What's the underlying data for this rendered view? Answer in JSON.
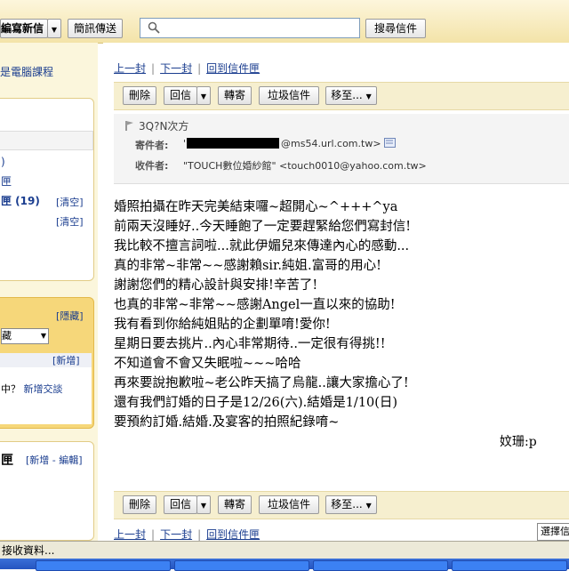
{
  "topbar": {
    "compose_label": "編寫新信",
    "im_label": "簡訊傳送",
    "search_placeholder": "",
    "search_button": "搜尋信件"
  },
  "sidebar": {
    "course_link": "電腦課程",
    "folder_count_fragment": ")",
    "folder_fragment": "匣",
    "trash_label": "匣 (19)",
    "clear_1": "[清空]",
    "clear_2": "[清空]",
    "hide_label": "[隱藏]",
    "dropdown_value": "藏",
    "add_label": "[新增]",
    "chat_fragment": "中？",
    "add_chat": "新增交談",
    "contacts_label": "匣",
    "contacts_actions": "[新增 - 編輯]"
  },
  "nav": {
    "prev": "上一封",
    "next": "下一封",
    "back": "回到信件匣"
  },
  "toolbar": {
    "delete": "刪除",
    "reply": "回信",
    "forward": "轉寄",
    "spam": "垃圾信件",
    "move": "移至..."
  },
  "header": {
    "subject": "3Q?N次方",
    "from_label": "寄件者:",
    "from_prefix": "'",
    "from_suffix": "@ms54.url.com.tw>",
    "to_label": "收件者:",
    "to_value": "\"TOUCH數位婚紗館\" <touch0010@yahoo.com.tw>"
  },
  "body": {
    "lines": [
      "婚照拍攝在昨天完美結束囉~超開心~^+++^ya",
      "前兩天沒睡好..今天睡飽了一定要趕緊給您們寫封信!",
      "我比較不擅言詞啦...就此伊媚兒來傳達內心的感動...",
      "真的非常~非常~~感謝賴sir.純姐.富哥的用心!",
      "謝謝您們的精心設計與安排!辛苦了!",
      "也真的非常~非常~~感謝Angel一直以來的協助!",
      "我有看到你給純姐貼的企劃單唷!愛你!",
      "星期日要去挑片..內心非常期待..一定很有得挑!!",
      "不知道會不會又失眠啦~~~哈哈",
      "再來要說抱歉啦~老公昨天搞了烏龍..讓大家擔心了!",
      "還有我們訂婚的日子是12/26(六).結婚是1/10(日)",
      "要預約訂婚.結婚.及宴客的拍照紀錄唷~"
    ],
    "signature": "妏珊:p"
  },
  "footer_nav": {
    "prev": "上一封",
    "next": "下一封",
    "back": "回到信件匣",
    "select_label": "選擇信"
  },
  "status": {
    "text": "接收資料..."
  },
  "colors": {
    "topbar": "#f3e3a8",
    "accent": "#1a3d8f",
    "toolbar": "#f6efcf"
  }
}
